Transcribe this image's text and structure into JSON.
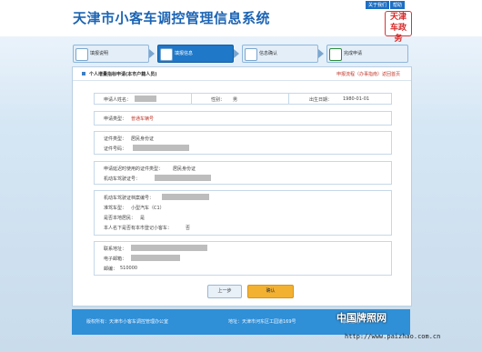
{
  "site": {
    "title": "天津市小客车调控管理信息系统",
    "top_links": [
      "关于我们",
      "帮助"
    ],
    "logo_text": "天津\n车\n政务"
  },
  "steps": [
    {
      "label": "填报说明"
    },
    {
      "label": "填报信息"
    },
    {
      "label": "信息确认"
    },
    {
      "label": "完成申请"
    }
  ],
  "panel": {
    "title": "个人增量指标申请(本市户籍人员)",
    "links": "申报流程（办事指南）返回首页"
  },
  "applicant": {
    "name_label": "申请人姓名：",
    "gender_label": "性别：",
    "gender_value": "男",
    "birth_label": "出生日期：",
    "birth_value": "1980-01-01"
  },
  "apply_type": {
    "label": "申请类型：",
    "value": "普通车辆号"
  },
  "id_info": {
    "type_label": "证件类型：",
    "type_value": "居民身份证",
    "number_label": "证件号码："
  },
  "agency_info": {
    "type_label": "申请延迟时使用的证件类型：",
    "type_value": "居民身份证",
    "number_label": "机动车驾驶证号："
  },
  "vehicle_info": {
    "license_label": "机动车驾驶证档案编号：",
    "class_label": "准驾车型：",
    "class_value": "小型汽车（C1）",
    "local_label": "是否本地居民：",
    "local_value": "是",
    "owned_label": "本人名下是否有本市登记小客车：",
    "owned_value": "否"
  },
  "contact_info": {
    "address_label": "联系地址：",
    "phone_label": "电子邮箱：",
    "postal_label": "邮编：",
    "postal_value": "510000"
  },
  "buttons": {
    "prev": "上一步",
    "confirm": "确认"
  },
  "footer": {
    "sponsor": "版权所有：天津市小客车调控管理办公室",
    "address": "地址：天津市河东区工园道169号",
    "contact": "邮政编码"
  },
  "watermark": {
    "brand": "中国牌照网",
    "url": "http://www.paizhao.com.cn"
  }
}
